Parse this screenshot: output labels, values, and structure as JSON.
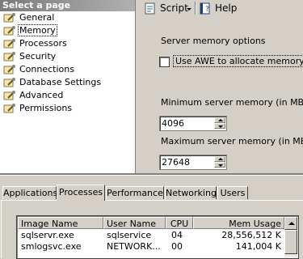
{
  "sidebar": {
    "header": "Select a page",
    "items": [
      {
        "label": "General"
      },
      {
        "label": "Memory"
      },
      {
        "label": "Processors"
      },
      {
        "label": "Security"
      },
      {
        "label": "Connections"
      },
      {
        "label": "Database Settings"
      },
      {
        "label": "Advanced"
      },
      {
        "label": "Permissions"
      }
    ],
    "selected_index": 1
  },
  "toolbar": {
    "script_label": "Script",
    "help_label": "Help"
  },
  "options": {
    "section_title": "Server memory options",
    "awe_label": "Use AWE to allocate memory",
    "awe_checked": false,
    "min_label": "Minimum server memory (in MB):",
    "min_value": "4096",
    "max_label": "Maximum server memory (in MB):",
    "max_value": "27648"
  },
  "taskmanager": {
    "tabs": [
      {
        "label": "Applications"
      },
      {
        "label": "Processes"
      },
      {
        "label": "Performance"
      },
      {
        "label": "Networking"
      },
      {
        "label": "Users"
      }
    ],
    "active_tab": "Processes",
    "columns": [
      "Image Name",
      "User Name",
      "CPU",
      "Mem Usage"
    ],
    "rows": [
      {
        "image": "sqlservr.exe",
        "user": "sqlservice",
        "cpu": "04",
        "mem": "28,556,512 K"
      },
      {
        "image": "smlogsvc.exe",
        "user": "NETWORK...",
        "cpu": "00",
        "mem": "141,004 K"
      }
    ]
  },
  "colors": {
    "face": "#d4d0c8",
    "header_gradient_start": "#7b7b7b"
  }
}
